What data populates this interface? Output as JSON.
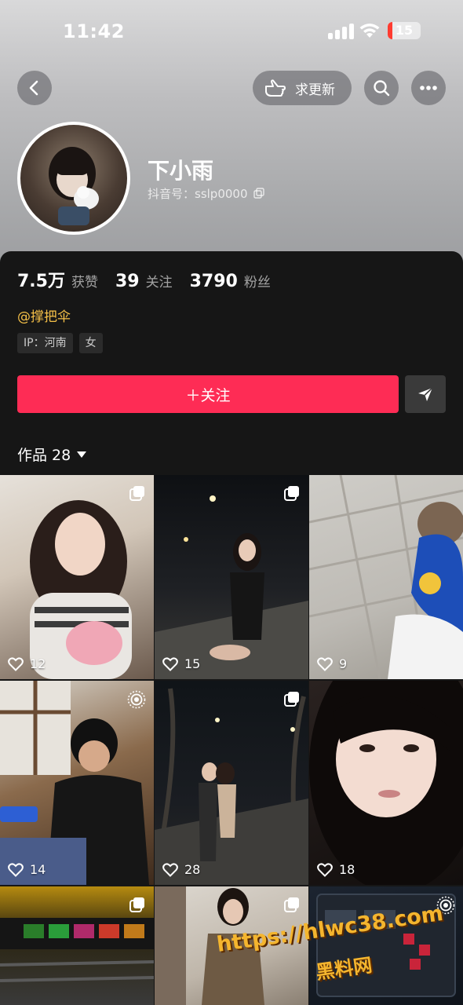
{
  "status_bar": {
    "time": "11:42",
    "battery": "15"
  },
  "header": {
    "update_label": "求更新"
  },
  "profile": {
    "nickname": "下小雨",
    "douyin_id": "抖音号：sslp0000",
    "mention": "@撑把伞",
    "tags": [
      "IP：河南",
      "女"
    ]
  },
  "stats": [
    {
      "num": "7.5万",
      "label": "获赞"
    },
    {
      "num": "39",
      "label": "关注"
    },
    {
      "num": "3790",
      "label": "粉丝"
    }
  ],
  "actions": {
    "follow_label": "＋关注"
  },
  "works": {
    "tab_label": "作品 28"
  },
  "grid": [
    {
      "likes": "12",
      "badge": "multi-image-icon"
    },
    {
      "likes": "15",
      "badge": "multi-image-icon"
    },
    {
      "likes": "9",
      "badge": ""
    },
    {
      "likes": "14",
      "badge": "live-photo-icon"
    },
    {
      "likes": "28",
      "badge": "multi-image-icon"
    },
    {
      "likes": "18",
      "badge": ""
    },
    {
      "likes": "",
      "badge": "multi-image-icon"
    },
    {
      "likes": "",
      "badge": "multi-image-icon"
    },
    {
      "likes": "",
      "badge": "live-photo-icon"
    }
  ],
  "watermark": {
    "url": "https://hlwc38.com",
    "name": "黑料网"
  },
  "colors": {
    "accent": "#fe2c55",
    "mention": "#f5c048",
    "background": "#161616"
  }
}
